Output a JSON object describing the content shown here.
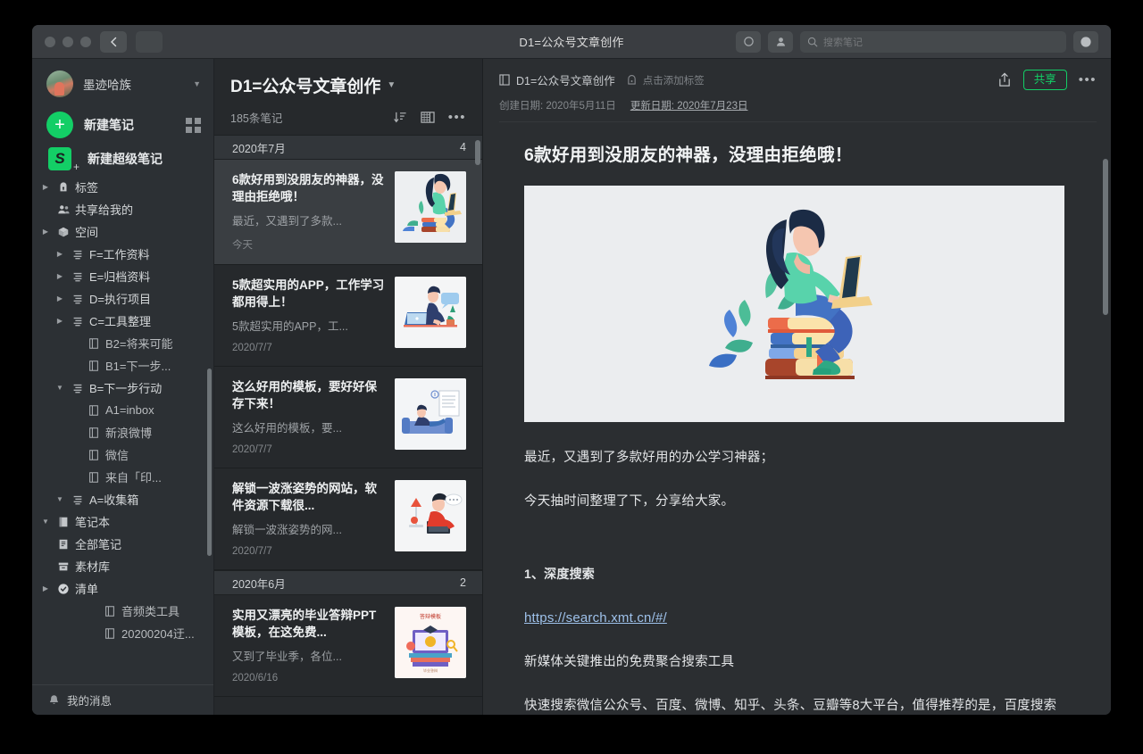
{
  "window": {
    "title": "D1=公众号文章创作",
    "search_placeholder": "搜索笔记"
  },
  "sidebar": {
    "account_name": "墨迹哈族",
    "new_note_label": "新建笔记",
    "new_super_note_label": "新建超级笔记",
    "tree": [
      {
        "label": "20200204迂...",
        "icon": "note-icon",
        "level": 3,
        "twist": ""
      },
      {
        "label": "音频类工具",
        "icon": "note-icon",
        "level": 3,
        "twist": ""
      },
      {
        "label": "清单",
        "icon": "check-circle-icon",
        "level": 0,
        "twist": "▶"
      },
      {
        "label": "素材库",
        "icon": "archive-icon",
        "level": 0,
        "twist": ""
      },
      {
        "label": "全部笔记",
        "icon": "all-notes-icon",
        "level": 0,
        "twist": ""
      },
      {
        "label": "笔记本",
        "icon": "notebook-icon",
        "level": 0,
        "twist": "▼"
      },
      {
        "label": "A=收集箱",
        "icon": "stack-icon",
        "level": 1,
        "twist": "▼"
      },
      {
        "label": "来自「印...",
        "icon": "note-icon",
        "level": 2,
        "twist": ""
      },
      {
        "label": "微信",
        "icon": "note-icon",
        "level": 2,
        "twist": ""
      },
      {
        "label": "新浪微博",
        "icon": "note-icon",
        "level": 2,
        "twist": ""
      },
      {
        "label": "A1=inbox",
        "icon": "note-icon",
        "level": 2,
        "twist": ""
      },
      {
        "label": "B=下一步行动",
        "icon": "stack-icon",
        "level": 1,
        "twist": "▼"
      },
      {
        "label": "B1=下一步...",
        "icon": "note-icon",
        "level": 2,
        "twist": ""
      },
      {
        "label": "B2=将来可能",
        "icon": "note-icon",
        "level": 2,
        "twist": ""
      },
      {
        "label": "C=工具整理",
        "icon": "stack-icon",
        "level": 1,
        "twist": "▶"
      },
      {
        "label": "D=执行项目",
        "icon": "stack-icon",
        "level": 1,
        "twist": "▶"
      },
      {
        "label": "E=归档资料",
        "icon": "stack-icon",
        "level": 1,
        "twist": "▶"
      },
      {
        "label": "F=工作资料",
        "icon": "stack-icon",
        "level": 1,
        "twist": "▶"
      },
      {
        "label": "空间",
        "icon": "cube-icon",
        "level": 0,
        "twist": "▶"
      },
      {
        "label": "共享给我的",
        "icon": "people-icon",
        "level": 0,
        "twist": ""
      },
      {
        "label": "标签",
        "icon": "tag-icon",
        "level": 0,
        "twist": "▶"
      }
    ],
    "footer_label": "我的消息"
  },
  "notelist": {
    "title": "D1=公众号文章创作",
    "count_label": "185条笔记",
    "groups": [
      {
        "label": "2020年7月",
        "count": "4",
        "notes": [
          {
            "title": "6款好用到没朋友的神器，没理由拒绝哦！",
            "snippet": "最近，又遇到了多款...",
            "date": "今天",
            "thumb": "woman-on-books",
            "selected": true
          },
          {
            "title": "5款超实用的APP，工作学习都用得上！",
            "snippet": "5款超实用的APP，工...",
            "date": "2020/7/7",
            "thumb": "man-at-desk",
            "selected": false
          },
          {
            "title": "这么好用的模板，要好好保存下来！",
            "snippet": "这么好用的模板，要...",
            "date": "2020/7/7",
            "thumb": "person-on-sofa",
            "selected": false
          },
          {
            "title": "解锁一波涨姿势的网站，软件资源下载很...",
            "snippet": "解锁一波涨姿势的网...",
            "date": "2020/7/7",
            "thumb": "man-red-shirt",
            "selected": false
          }
        ]
      },
      {
        "label": "2020年6月",
        "count": "2",
        "notes": [
          {
            "title": "实用又漂亮的毕业答辩PPT模板，在这免费...",
            "snippet": "又到了毕业季，各位...",
            "date": "2020/6/16",
            "thumb": "graduation-ppt",
            "selected": false
          }
        ]
      }
    ]
  },
  "editor": {
    "notebook": "D1=公众号文章创作",
    "add_tag_label": "点击添加标签",
    "share_label": "共享",
    "created_label": "创建日期: 2020年5月11日",
    "updated_label": "更新日期: 2020年7月23日",
    "doc_title": "6款好用到没朋友的神器，没理由拒绝哦！",
    "paragraphs": [
      {
        "kind": "text",
        "text": "最近，又遇到了多款好用的办公学习神器；"
      },
      {
        "kind": "text",
        "text": "今天抽时间整理了下，分享给大家。"
      },
      {
        "kind": "spacer",
        "text": ""
      },
      {
        "kind": "heading",
        "text": "1、深度搜索"
      },
      {
        "kind": "link",
        "text": "https://search.xmt.cn/#/"
      },
      {
        "kind": "text",
        "text": "新媒体关键推出的免费聚合搜索工具"
      },
      {
        "kind": "text",
        "text": "快速搜索微信公众号、百度、微博、知乎、头条、豆瓣等8大平台，值得推荐的是，百度搜索没有竞价广告，使用更高效。"
      }
    ]
  },
  "colors": {
    "accent_green": "#13ce66",
    "sidebar_bg": "#2c3034",
    "list_bg": "#26292c",
    "editor_bg": "#2b2e31",
    "link_blue": "#9ec1ea"
  }
}
